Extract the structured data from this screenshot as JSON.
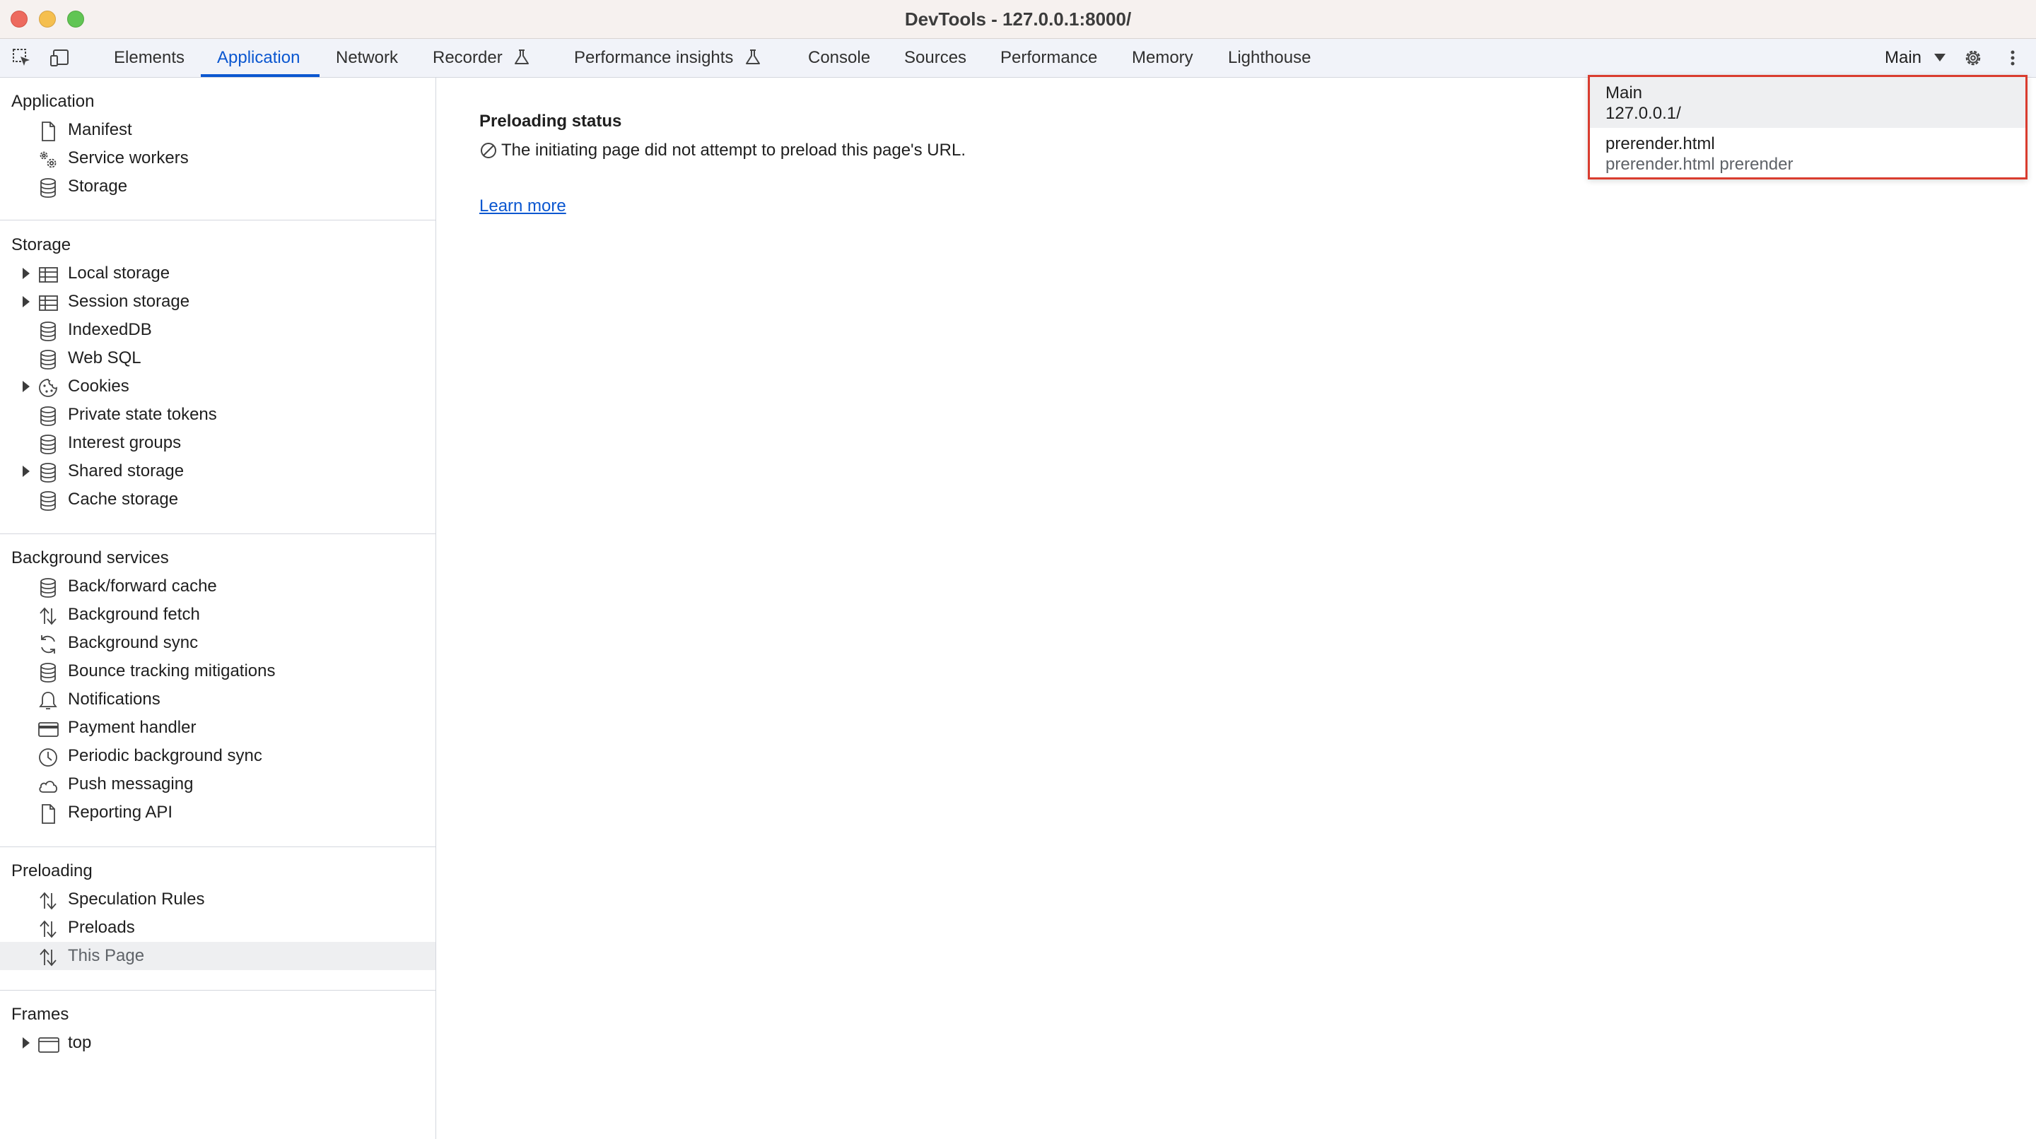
{
  "window": {
    "title": "DevTools - 127.0.0.1:8000/"
  },
  "toolbar": {
    "tabs": [
      {
        "label": "Elements"
      },
      {
        "label": "Application"
      },
      {
        "label": "Network"
      },
      {
        "label": "Recorder"
      },
      {
        "label": "Performance insights"
      },
      {
        "label": "Console"
      },
      {
        "label": "Sources"
      },
      {
        "label": "Performance"
      },
      {
        "label": "Memory"
      },
      {
        "label": "Lighthouse"
      }
    ],
    "active_tab": "Application",
    "target_select": "Main"
  },
  "sidebar": {
    "sections": [
      {
        "title": "Application",
        "items": [
          {
            "label": "Manifest",
            "icon": "document-icon"
          },
          {
            "label": "Service workers",
            "icon": "gears-icon"
          },
          {
            "label": "Storage",
            "icon": "database-icon"
          }
        ]
      },
      {
        "title": "Storage",
        "items": [
          {
            "label": "Local storage",
            "icon": "table-icon",
            "expandable": true
          },
          {
            "label": "Session storage",
            "icon": "table-icon",
            "expandable": true
          },
          {
            "label": "IndexedDB",
            "icon": "database-icon"
          },
          {
            "label": "Web SQL",
            "icon": "database-icon"
          },
          {
            "label": "Cookies",
            "icon": "cookie-icon",
            "expandable": true
          },
          {
            "label": "Private state tokens",
            "icon": "database-icon"
          },
          {
            "label": "Interest groups",
            "icon": "database-icon"
          },
          {
            "label": "Shared storage",
            "icon": "database-icon",
            "expandable": true
          },
          {
            "label": "Cache storage",
            "icon": "database-icon"
          }
        ]
      },
      {
        "title": "Background services",
        "items": [
          {
            "label": "Back/forward cache",
            "icon": "database-icon"
          },
          {
            "label": "Background fetch",
            "icon": "arrows-updown-icon"
          },
          {
            "label": "Background sync",
            "icon": "sync-icon"
          },
          {
            "label": "Bounce tracking mitigations",
            "icon": "database-icon"
          },
          {
            "label": "Notifications",
            "icon": "bell-icon"
          },
          {
            "label": "Payment handler",
            "icon": "card-icon"
          },
          {
            "label": "Periodic background sync",
            "icon": "clock-icon"
          },
          {
            "label": "Push messaging",
            "icon": "cloud-icon"
          },
          {
            "label": "Reporting API",
            "icon": "document-icon"
          }
        ]
      },
      {
        "title": "Preloading",
        "items": [
          {
            "label": "Speculation Rules",
            "icon": "arrows-updown-icon"
          },
          {
            "label": "Preloads",
            "icon": "arrows-updown-icon"
          },
          {
            "label": "This Page",
            "icon": "arrows-updown-icon",
            "selected": true
          }
        ]
      },
      {
        "title": "Frames",
        "items": [
          {
            "label": "top",
            "icon": "frame-icon",
            "expandable": true
          }
        ]
      }
    ]
  },
  "main": {
    "title": "Preloading status",
    "message": "The initiating page did not attempt to preload this page's URL.",
    "learn_more": "Learn more"
  },
  "dropdown": {
    "options": [
      {
        "label": "Main",
        "sub": "127.0.0.1/",
        "highlighted": true
      },
      {
        "label": "prerender.html",
        "sub": "prerender.html prerender",
        "highlighted": false
      }
    ]
  },
  "colors": {
    "accent": "#0b57d0",
    "dropdown_border": "#d93c2f",
    "selected_bg": "#eeeff1"
  }
}
